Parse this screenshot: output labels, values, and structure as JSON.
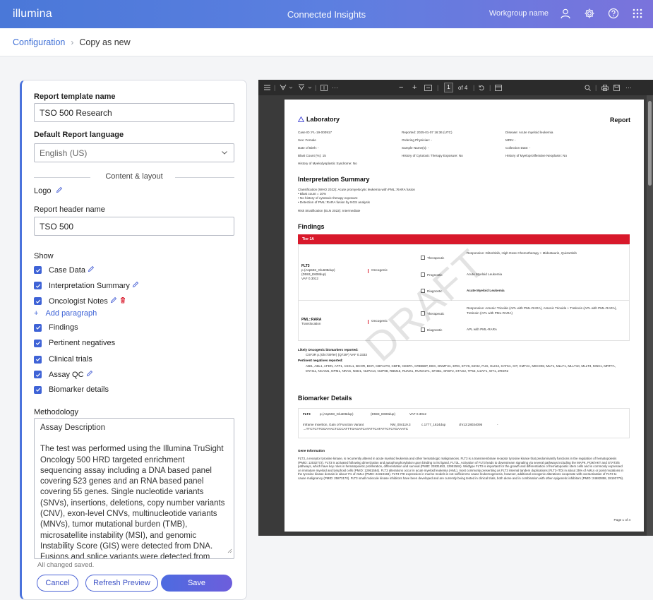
{
  "header": {
    "brand": "illumina",
    "app_title": "Connected Insights",
    "workgroup": "Workgroup name",
    "icons": [
      "user-icon",
      "gear-icon",
      "help-icon",
      "apps-grid-icon"
    ]
  },
  "breadcrumb": {
    "parent": "Configuration",
    "current": "Copy as new"
  },
  "form": {
    "template_name_label": "Report template name",
    "template_name_value": "TSO 500 Research",
    "language_label": "Default Report language",
    "language_value": "English (US)",
    "content_divider": "Content & layout",
    "logo_label": "Logo",
    "header_name_label": "Report header name",
    "header_name_value": "TSO 500",
    "show_label": "Show",
    "show_items": [
      {
        "label": "Case Data",
        "checked": true,
        "editable": true
      },
      {
        "label": "Interpretation Summary",
        "checked": true,
        "editable": true
      },
      {
        "label": "Oncologist Notes",
        "checked": true,
        "editable": true,
        "deletable": true
      },
      {
        "label": "Findings",
        "checked": true
      },
      {
        "label": "Pertinent negatives",
        "checked": true
      },
      {
        "label": "Clinical trials",
        "checked": true
      },
      {
        "label": "Assay QC",
        "checked": true,
        "editable": true
      },
      {
        "label": "Biomarker details",
        "checked": true
      }
    ],
    "add_paragraph": "Add paragraph",
    "methodology_label": "Methodology",
    "methodology_title": "Assay Description",
    "methodology_text": "The test was performed using the Illumina TruSight Oncology 500 HRD targeted enrichment sequencing assay including a DNA based panel covering 523 genes and an RNA based panel covering 55 genes. Single nucleotide variants (SNVs), insertions, deletions, copy number variants (CNV), exon-level CNVs, multinucleotide variants (MNVs), tumor mutational burden (TMB), microsatellite instability (MSI), and genomic Instability Score (GIS) were detected from DNA. Fusions and splice variants were detected from RNA.",
    "saved_status": "All changed saved.",
    "cancel_label": "Cancel",
    "refresh_label": "Refresh Preview",
    "save_label": "Save"
  },
  "viewer": {
    "current_page": "1",
    "page_total": "of 4",
    "zoom_minus": "−",
    "zoom_plus": "+"
  },
  "report": {
    "lab": "Laboratory",
    "report_label": "Report",
    "case_id": "Case ID: FL-19-000917",
    "reported": "Reported: 2025-01-07 16:36 (UTC)",
    "disease": "Disease: Acute myeloid leukemia",
    "sex": "Sex: Female",
    "ordering": "Ordering Physician: -",
    "mrn": "MRN: -",
    "dob": "Date of Birth: -",
    "sample": "Sample Name(s): -",
    "collection": "Collection Date: -",
    "blast": "Blast Count (%): 15",
    "cytotoxic": "History of Cytotoxic Therapy Exposure: No",
    "myeloprolif": "History of Myeloproliferative Neoplasm: No",
    "myelodys": "History of Myelodysplastic Syndrome: No",
    "interp_title": "Interpretation Summary",
    "interp_lines": [
      "Classification (WHO 2022): Acute promyelocytic leukemia with PML::RARA fusion",
      "• Blast count = 10%",
      "• No history of cytotoxic therapy exposure",
      "• Detection of PML::RARA fusion by NGS analysis"
    ],
    "risk": "Risk Stratification (ELN 2022): Intermediate",
    "findings_title": "Findings",
    "tier": "Tier 1A",
    "flt3_gene": "FLT3",
    "flt3_lines": [
      "p.(Asp593_Glu608dup)",
      "(D593_E608dup)",
      "VAF 0.3012"
    ],
    "oncogenic": "Oncogenic",
    "therapeutic": "Therapeutic",
    "prognostic": "Prognostic",
    "diagnostic": "Diagnostic",
    "flt3_ther": "Responsive: Gilteritinib, High Dose Chemotherapy + Midostaurin, Quizartinib",
    "flt3_prog": "Acute Myeloid Leukemia",
    "flt3_diag": "Acute Myeloid Leukemia",
    "pml_gene": "PML::RARA",
    "pml_sub": "Translocation",
    "pml_ther": "Responsive: Arsenic Trioxide (APL with PML-RARA), Arsenic Trioxide + Tretinoin (APL with PML-RARA), Tretinoin (APL with PML-RARA)",
    "pml_diag": "APL with PML-RARA",
    "watermark": "DRAFT",
    "likely_title": "Likely Oncogenic biomarkers reported:",
    "likely_item": "CSF3R p.(Gln739Ter) (Q739*) VAF 0.3333",
    "pertneg_title": "Pertinent negatives reported:",
    "pertneg_item": "ABI1, ABL1, AFDN, AFF1, ASXL1, BCOR, BCR, CBFA2T3, CBFB, CEBPA, CREBBP, DEK, DNMT3A, ERG, ETV6, EZH2, FUS, GLIS2, KAT6A, KIT, KMT2A, MECOM, MLF1, MLLT1, MLLT10, MLLT3, MNX1, MRTFA, MYH11, NCAM1, NPM1, NRAS, NSD1, NUP214, NUP98, RBM15, RUNX1, RUNX1T1, SF3B1, SRSF2, STAG2, TP53, U2AF1, WT1, ZRSR2",
    "bm_title": "Biomarker Details",
    "bm_gene": "FLT3",
    "bm_variant": "p.(Asp593_Glu608dup)",
    "bm_short": "(D593_E608dup)",
    "bm_vaf": "VAF 0.3012",
    "bm_type": "Inframe Insertion, Gain of Function Variant",
    "bm_nm": "NM_004119.3",
    "bm_c": "c.1777_1824dup",
    "bm_chr": "chr13:28034095",
    "bm_dash": "-",
    "bm_seq": "→TTCTCTTGGAAACTCCCATTTGAGATCATATTCATATTCTCTGAAATC",
    "gene_info_title": "Gene Information",
    "gene_info": "FLT3, a receptor tyrosine kinase, is recurrently altered in acute myeloid leukemia and other hematologic malignancies. FLT3 is a transmembrane receptor tyrosine kinase that predominantly functions in the regulation of hematopoiesis (PMID: 12032772). FLT3 is activated following dimerization and autophosphorylation upon binding to its ligand, FLT3L. Activation of FLT3 leads to downstream signaling via several pathways including the MAPK, PI3K/AKT and STAT3/5 pathways, which have key roles in hematopoietic proliferation, differentiation and survival (PMID: 23831653, 12951584). Wildtype FLT3 is important for the growth and differentiation of hematopoietic stem cells and is commonly expressed on immature myeloid and lymphoid cells (PMID: 12951584). FLT3 alterations occur in acute myeloid leukemia (AML), most commonly presenting as FLT3 internal tandem duplications (FLT3-ITD) in about 25% of AMLs or point mutations in the tyrosine kinase domain in about 7% of AMLs (PMID: 24319184). FLT3-ITD expression in murine models is not sufficient to cause leukemogenesis, however, additional oncogenic alterations cooperate with overactivation of FLT3 to cause malignancy (PMID: 25873170). FLT3 small molecule kinase inhibitors have been developed and are currently being tested in clinical trials, both alone and in combination with other epigenetic inhibitors (PMID: 24682858, 28193779).",
    "footer": "Page 1 of 4"
  },
  "colors": {
    "accent": "#4b73dc",
    "tier_red": "#d8192b"
  }
}
